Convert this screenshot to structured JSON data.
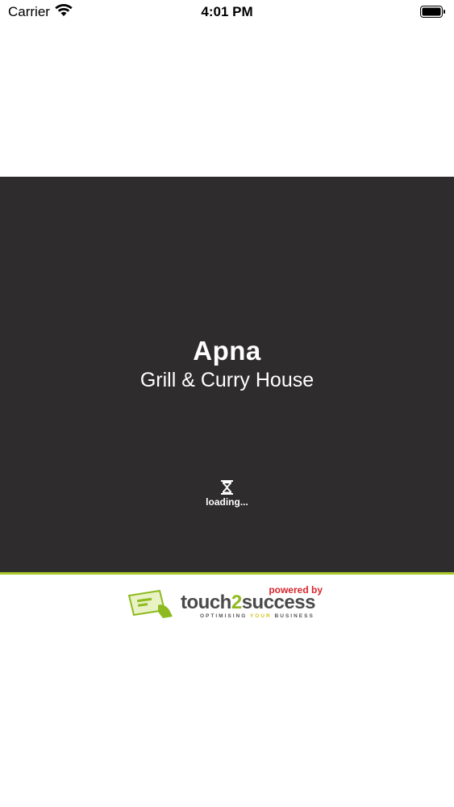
{
  "status_bar": {
    "carrier": "Carrier",
    "time": "4:01 PM",
    "icons": [
      "wifi-icon",
      "battery-icon"
    ]
  },
  "splash": {
    "background_color": "#2e2c2c",
    "title": "Apna",
    "subtitle": "Grill & Curry House",
    "loading_icon": "hourglass-icon",
    "loading_text": "loading..."
  },
  "accent_color": "#a8c82a",
  "footer": {
    "powered_by": "powered by",
    "brand_prefix": "touch",
    "brand_number": "2",
    "brand_suffix": "success",
    "tagline_start": "OPTIMISING ",
    "tagline_highlight": "YOUR",
    "tagline_end": " BUSINESS",
    "logo_icon": "card-terminal-icon",
    "colors": {
      "red": "#d6262c",
      "green": "#8dba1f",
      "yellow": "#d6c21a"
    }
  }
}
